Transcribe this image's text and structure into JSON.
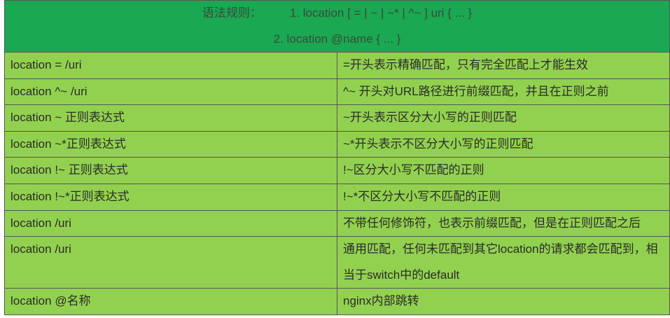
{
  "header": {
    "lead": "语法规则：",
    "line1": "1. location [ = | ~ | ~*   | ^~ ] uri { ... }",
    "line2": "2. location @name { ... }"
  },
  "rows": [
    {
      "pattern": "location = /uri",
      "desc": "=开头表示精确匹配，只有完全匹配上才能生效"
    },
    {
      "pattern": "location ^~ /uri",
      "desc": "^~ 开头对URL路径进行前缀匹配，并且在正则之前"
    },
    {
      "pattern": "location ~ 正则表达式",
      "desc": "~开头表示区分大小写的正则匹配"
    },
    {
      "pattern": "location ~*正则表达式",
      "desc": "~*开头表示不区分大小写的正则匹配"
    },
    {
      "pattern": "location !~ 正则表达式",
      "desc": "!~区分大小写不匹配的正则"
    },
    {
      "pattern": "location !~*正则表达式",
      "desc": "!~*不区分大小写不匹配的正则"
    },
    {
      "pattern": "location /uri",
      "desc": "不带任何修饰符，也表示前缀匹配，但是在正则匹配之后"
    },
    {
      "pattern": "location /uri",
      "desc": "通用匹配，任何未匹配到其它location的请求都会匹配到，相当于switch中的default"
    },
    {
      "pattern": "location @名称",
      "desc": "nginx内部跳转"
    }
  ],
  "colors": {
    "header_bg": "#1aa853",
    "row_bg": "#92d14f",
    "border": "#555555"
  }
}
